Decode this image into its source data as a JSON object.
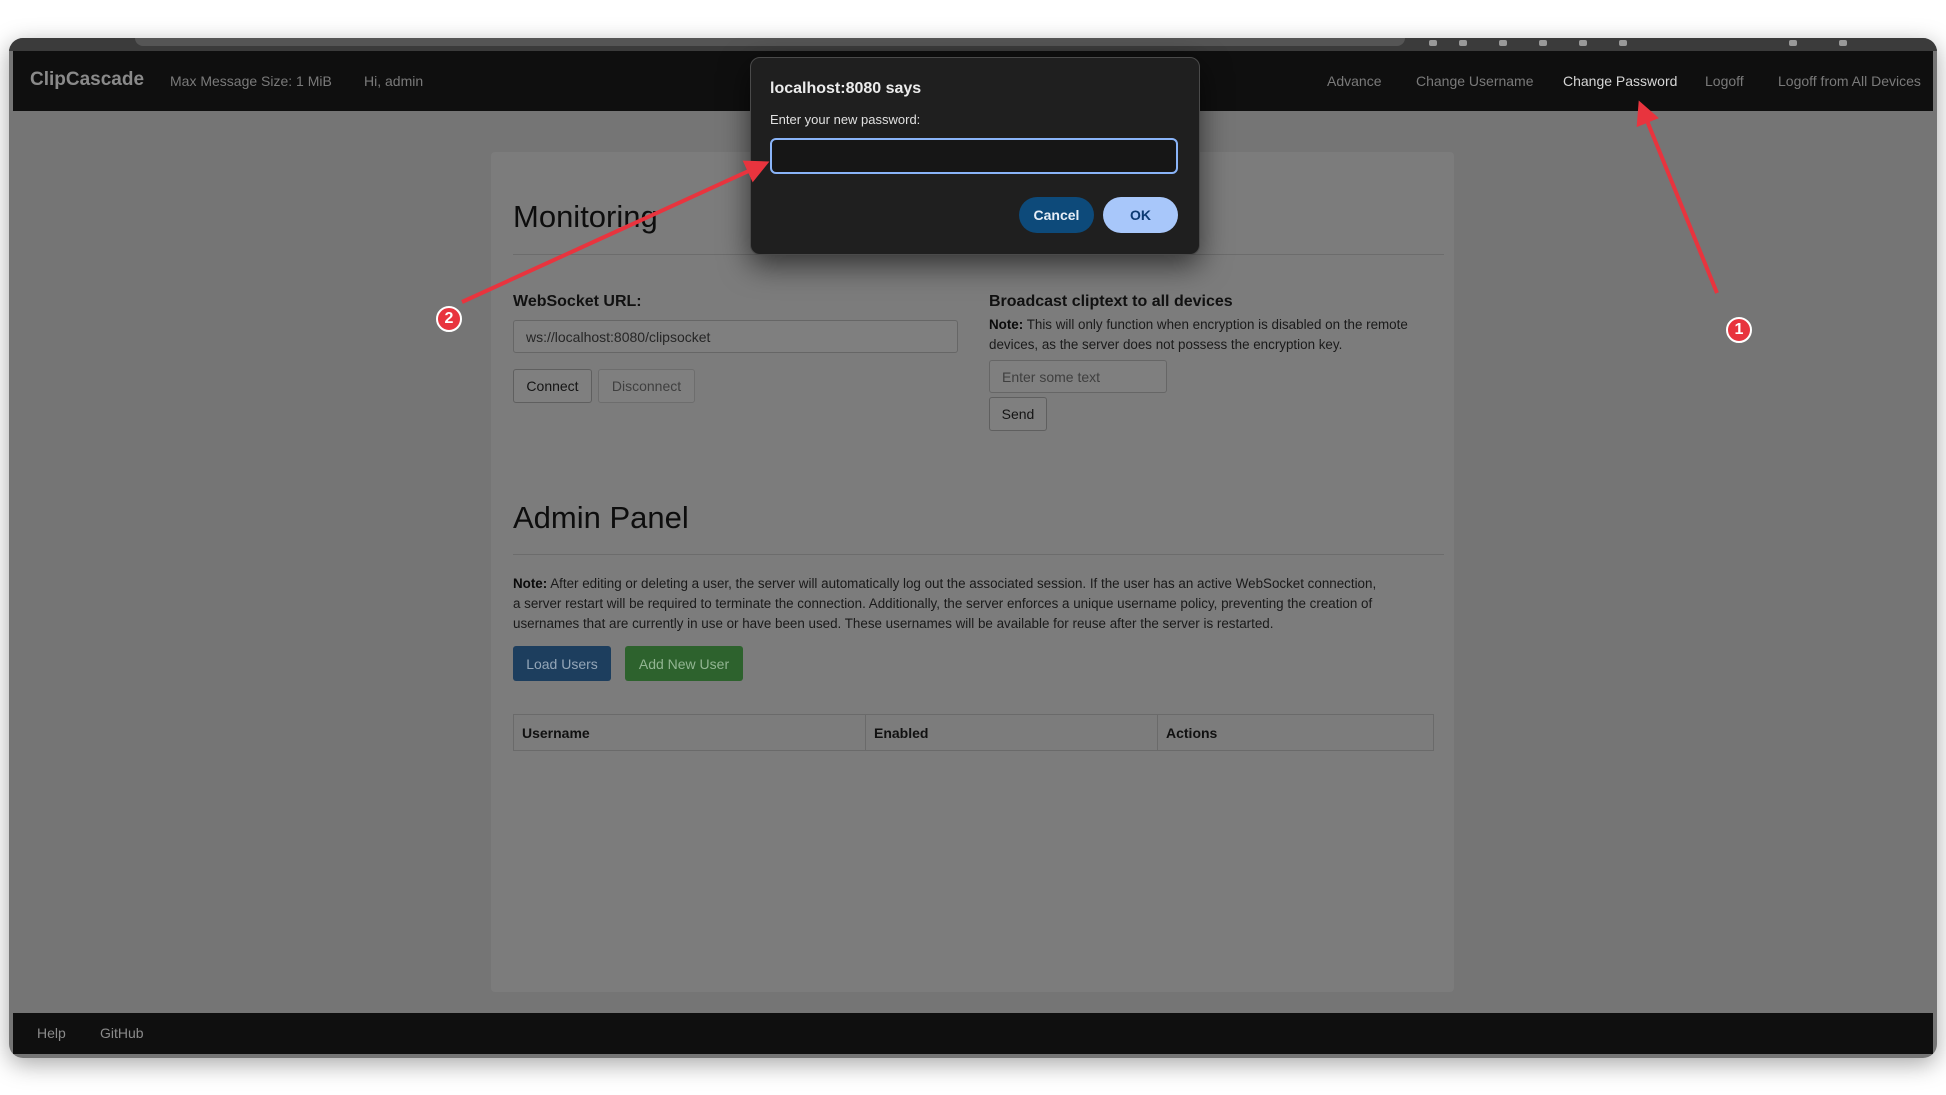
{
  "navbar": {
    "brand": "ClipCascade",
    "max_message_size": "Max Message Size: 1 MiB",
    "greeting": "Hi, admin",
    "links": [
      "Advance",
      "Change Username",
      "Change Password",
      "Logoff",
      "Logoff from All Devices"
    ],
    "active_link": "Change Password"
  },
  "monitoring": {
    "heading": "Monitoring",
    "websocket_label": "WebSocket URL:",
    "websocket_url": "ws://localhost:8080/clipsocket",
    "connect_label": "Connect",
    "disconnect_label": "Disconnect",
    "broadcast_heading": "Broadcast cliptext to all devices",
    "broadcast_note_prefix": "Note:",
    "broadcast_note_line1": " This will only function when encryption is disabled on the remote",
    "broadcast_note_line2": "devices, as the server does not possess the encryption key.",
    "broadcast_placeholder": "Enter some text",
    "send_label": "Send"
  },
  "admin": {
    "heading": "Admin Panel",
    "note_prefix": "Note:",
    "note_line1": " After editing or deleting a user, the server will automatically log out the associated session. If the user has an active WebSocket connection,",
    "note_line2": "a server restart will be required to terminate the connection. Additionally, the server enforces a unique username policy, preventing the creation of",
    "note_line3": "usernames that are currently in use or have been used. These usernames will be available for reuse after the server is restarted.",
    "load_users_label": "Load Users",
    "add_user_label": "Add New User",
    "table_headers": [
      "Username",
      "Enabled",
      "Actions"
    ]
  },
  "footer": {
    "links": [
      "Help",
      "GitHub"
    ]
  },
  "dialog": {
    "title": "localhost:8080 says",
    "message": "Enter your new password:",
    "input_value": "",
    "cancel_label": "Cancel",
    "ok_label": "OK"
  },
  "annotations": {
    "badge_1": "1",
    "badge_2": "2"
  },
  "colors": {
    "annotation_red": "#e8343e",
    "focus_ring": "#8ab4f8",
    "ok_button": "#a8c7fa",
    "cancel_button": "#0d4a7a"
  }
}
